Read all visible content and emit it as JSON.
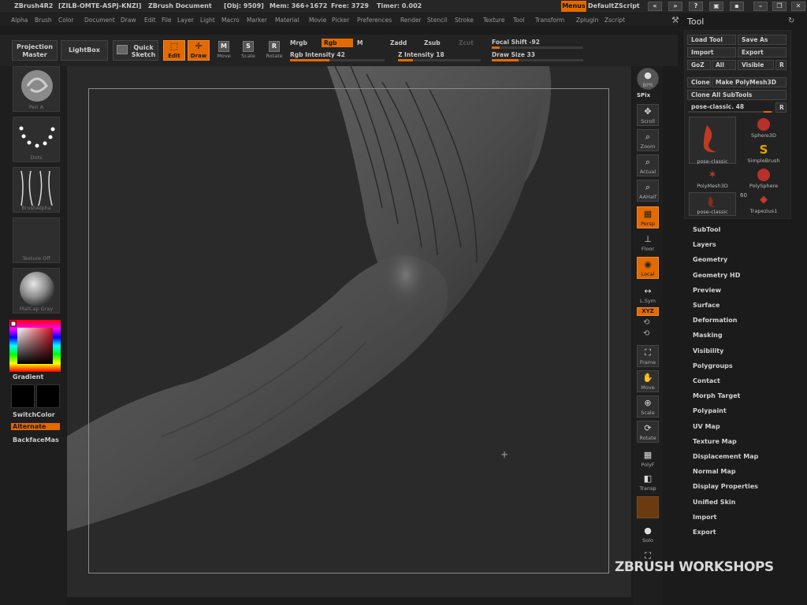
{
  "titlebar": {
    "app": "ZBrush4R2",
    "serial": "[ZILB-OMTE-ASPJ-KNZI]",
    "doc": "ZBrush Document",
    "obj": "[Obj: 9509]",
    "mem": "Mem: 366+1672",
    "free": "Free: 3729",
    "timer": "Timer: 0.002",
    "menus": "Menus",
    "script": "DefaultZScript"
  },
  "menubar": [
    "Alpha",
    "Brush",
    "Color",
    "Document",
    "Draw",
    "Edit",
    "File",
    "Layer",
    "Light",
    "Macro",
    "Marker",
    "Material",
    "Movie",
    "Picker",
    "Preferences",
    "Render",
    "Stencil",
    "Stroke",
    "Texture",
    "Tool",
    "Transform",
    "Zplugin",
    "Zscript"
  ],
  "toolbar": {
    "projection_master": "Projection Master",
    "lightbox": "LightBox",
    "quick_sketch": "Quick Sketch",
    "edit": "Edit",
    "draw": "Draw",
    "move": "Move",
    "scale": "Scale",
    "rotate": "Rotate",
    "move_key": "M",
    "scale_key": "S",
    "rotate_key": "R",
    "mrgb": "Mrgb",
    "rgb": "Rgb",
    "m": "M",
    "rgb_intensity": "Rgb Intensity 42",
    "zadd": "Zadd",
    "zsub": "Zsub",
    "zcut": "Zcut",
    "z_intensity": "Z Intensity 18",
    "focal_shift": "Focal Shift -92",
    "draw_size": "Draw Size 33",
    "rgb_intensity_value": 42,
    "z_intensity_value": 18,
    "draw_size_value": 33
  },
  "leftshelf": {
    "brush_label": "Pen A",
    "stroke_label": "Dots",
    "alpha_label": "BrushAlpha",
    "texture_label": "Texture Off",
    "material_label": "MatCap Gray",
    "gradient": "Gradient",
    "switchcolor": "SwitchColor",
    "alternate": "Alternate",
    "backface": "BackfaceMas"
  },
  "rightshelf": {
    "bpr": "BPR",
    "spix": "SPix",
    "scroll": "Scroll",
    "zoom": "Zoom",
    "actual": "Actual",
    "aahalf": "AAHalf",
    "persp": "Persp",
    "floor": "Floor",
    "local": "Local",
    "lsym": "L.Sym",
    "xyz": "XYZ",
    "frame": "Frame",
    "move": "Move",
    "scale": "Scale",
    "rotate": "Rotate",
    "polyf": "PolyF",
    "transp": "Transp",
    "solo": "Solo"
  },
  "toolpanel": {
    "title": "Tool",
    "load_tool": "Load Tool",
    "save_as": "Save As",
    "import": "Import",
    "export": "Export",
    "goz": "GoZ",
    "all": "All",
    "visible": "Visible",
    "r": "R",
    "clone": "Clone",
    "make_polymesh": "Make PolyMesh3D",
    "clone_all": "Clone All SubTools",
    "current_tool": "pose-classic. 48",
    "thumbs": [
      {
        "label": "pose-classic"
      },
      {
        "label": "Sphere3D"
      },
      {
        "label": "SimpleBrush"
      },
      {
        "label": "PolyMesh3D"
      },
      {
        "label": "PolySphere"
      },
      {
        "label": "pose-classic"
      },
      {
        "label": "Trapezius1"
      }
    ],
    "count_60": "60",
    "sections": [
      "SubTool",
      "Layers",
      "Geometry",
      "Geometry HD",
      "Preview",
      "Surface",
      "Deformation",
      "Masking",
      "Visibility",
      "Polygroups",
      "Contact",
      "Morph Target",
      "Polypaint",
      "UV Map",
      "Texture Map",
      "Displacement Map",
      "Normal Map",
      "Display Properties",
      "Unified Skin",
      "Import",
      "Export"
    ]
  },
  "watermark": "ZBRUSH WORKSHOPS",
  "colors": {
    "accent": "#e36a00",
    "bg": "#1b1b1b",
    "canvas": "#2a2a2a"
  }
}
